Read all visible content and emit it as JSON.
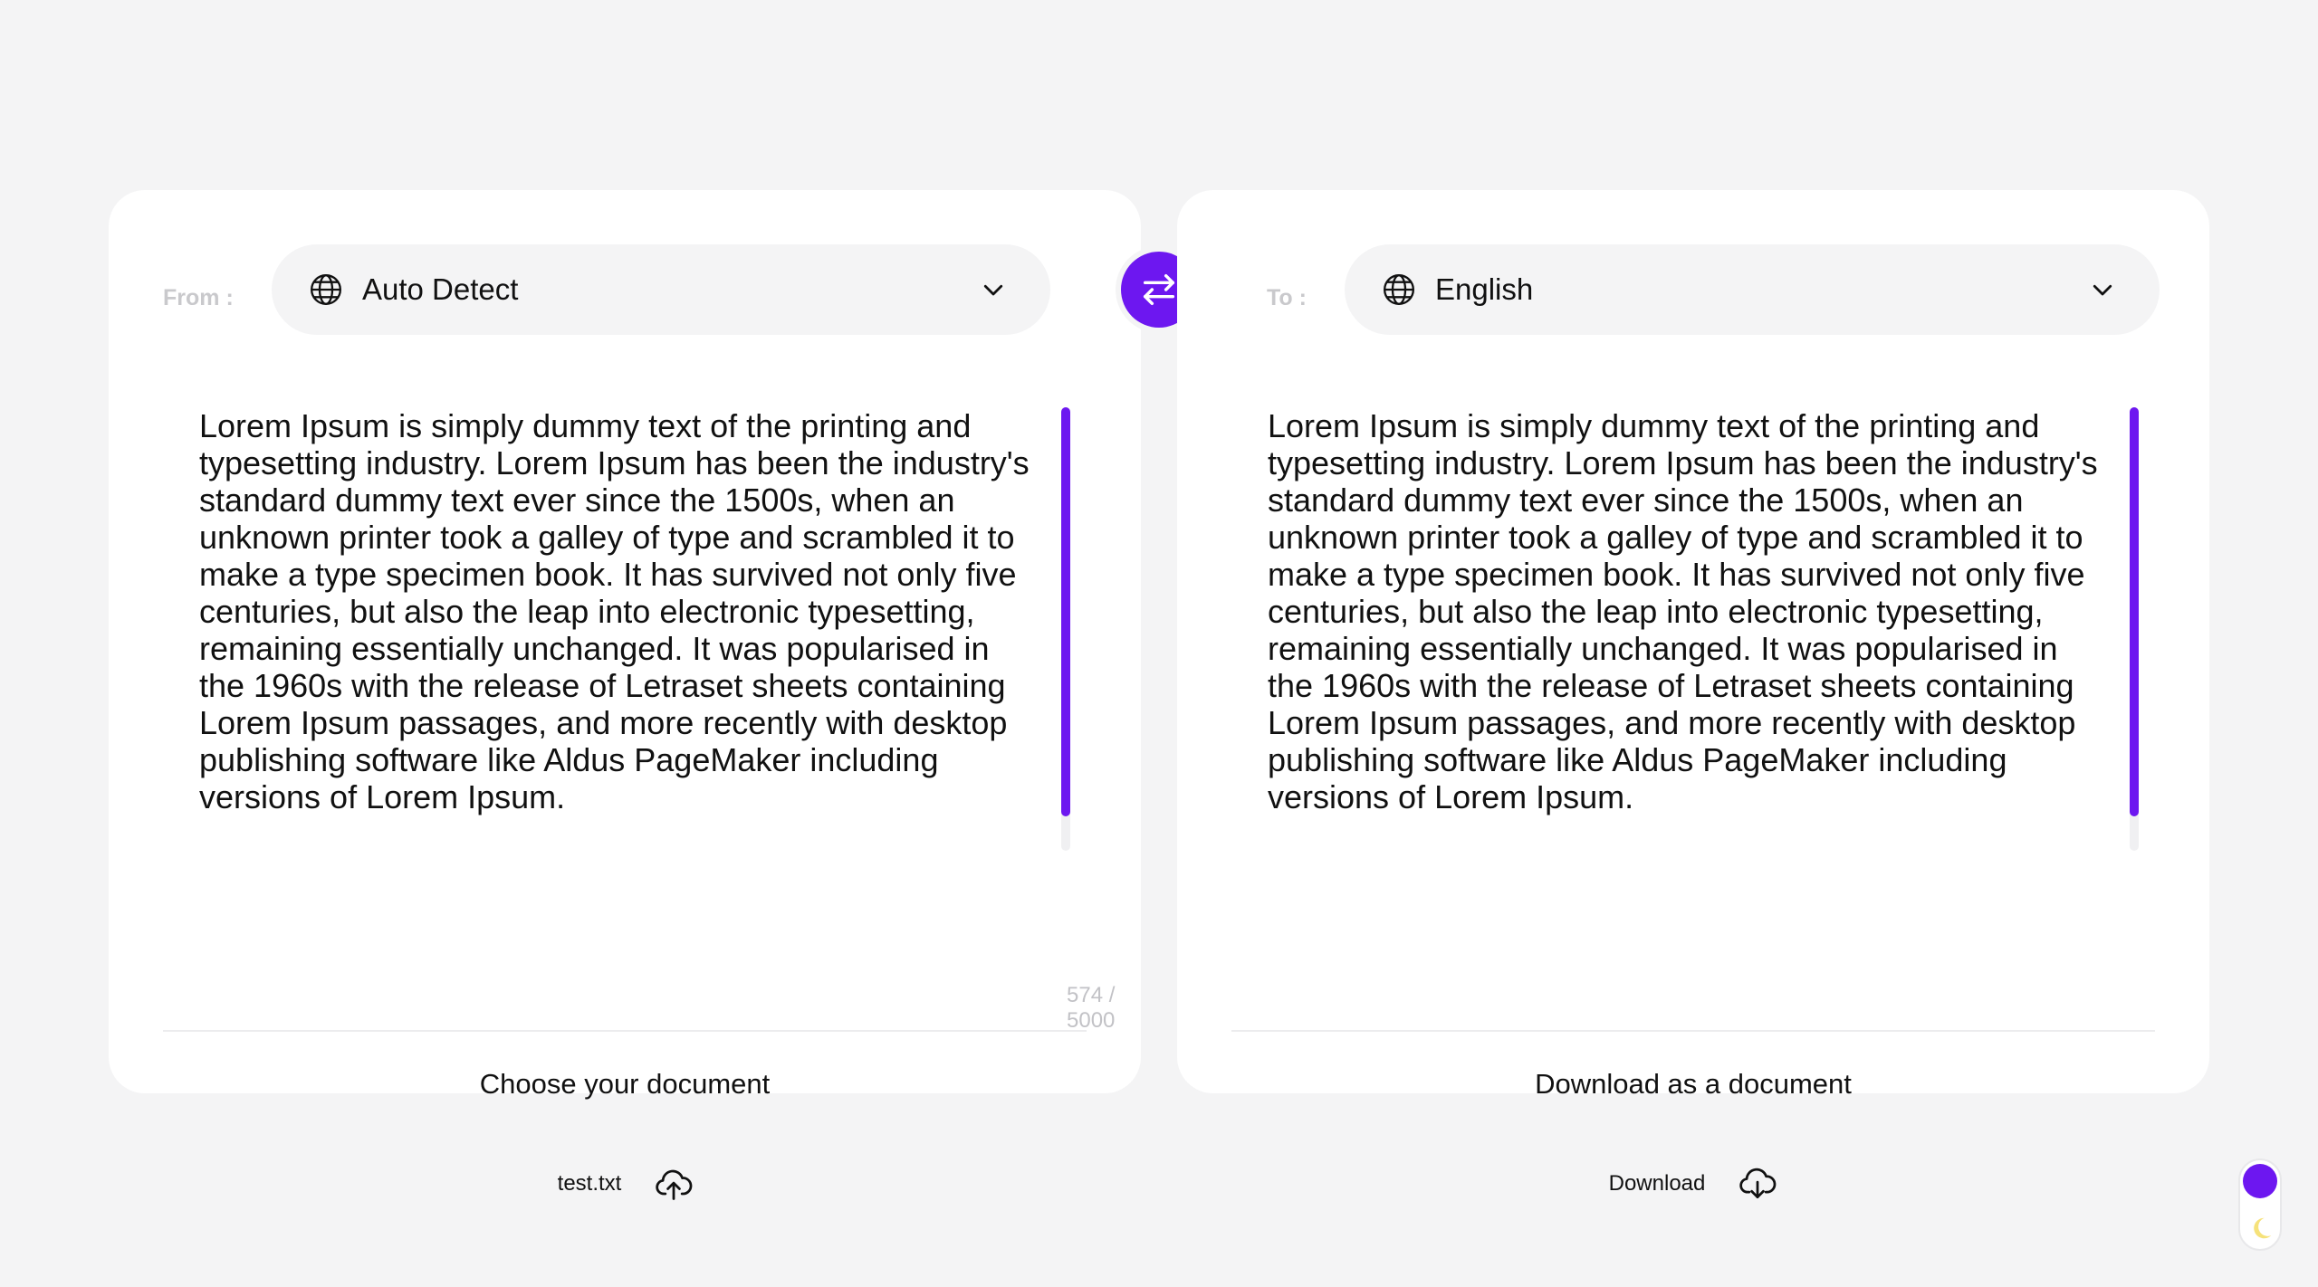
{
  "accent_color": "#6d17f0",
  "source": {
    "label": "From :",
    "language": "Auto Detect",
    "text": "Lorem Ipsum is simply dummy text of the printing and typesetting industry. Lorem Ipsum has been the industry's standard dummy text ever since the 1500s, when an unknown printer took a galley of type and scrambled it to make a type specimen book. It has survived not only five centuries, but also the leap into electronic typesetting, remaining essentially unchanged. It was popularised in the 1960s with the release of Letraset sheets containing Lorem Ipsum passages, and more recently with desktop publishing software like Aldus PageMaker including versions of Lorem Ipsum.",
    "char_count": "574 / 5000",
    "doc_label": "Choose your document",
    "file_button": "test.txt",
    "icons": {
      "language": "globe-icon",
      "dropdown": "chevron-down-icon",
      "upload": "cloud-upload-icon"
    }
  },
  "target": {
    "label": "To :",
    "language": "English",
    "text": "Lorem Ipsum is simply dummy text of the printing and typesetting industry. Lorem Ipsum has been the industry's standard dummy text ever since the 1500s, when an unknown printer took a galley of type and scrambled it to make a type specimen book. It has survived not only five centuries, but also the leap into electronic typesetting, remaining essentially unchanged. It was popularised in the 1960s with the release of Letraset sheets containing Lorem Ipsum passages, and more recently with desktop publishing software like Aldus PageMaker including versions of Lorem Ipsum.",
    "doc_label": "Download as a document",
    "download_button": "Download",
    "icons": {
      "language": "globe-icon",
      "dropdown": "chevron-down-icon",
      "download": "cloud-download-icon"
    }
  },
  "swap_icon": "swap-arrows-icon",
  "theme_toggle": {
    "icon": "moon-icon"
  }
}
